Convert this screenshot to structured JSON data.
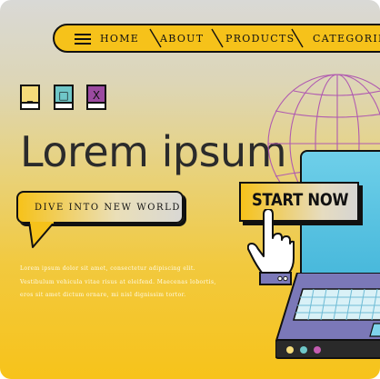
{
  "nav": {
    "items": [
      {
        "label": "HOME"
      },
      {
        "label": "ABOUT"
      },
      {
        "label": "PRODUCTS"
      },
      {
        "label": "CATEGORIES"
      }
    ]
  },
  "window_icons": [
    {
      "icon": "minimize-icon",
      "glyph": "_",
      "color": "#f6dc7a"
    },
    {
      "icon": "maximize-icon",
      "glyph": "□",
      "color": "#6fc7c8"
    },
    {
      "icon": "close-icon",
      "glyph": "X",
      "color": "#9b4aa0"
    }
  ],
  "hero": {
    "title": "Lorem ipsum",
    "bubble_label": "DIVE INTO NEW WORLD",
    "body_lines": [
      "Lorem ipsum dolor sit amet, consectetur adipiscing elit.",
      "Vestibulum vehicula vitae risus at eleifend. Maecenas lobortis,",
      "eros sit amet dictum ornare, mi nisl dignissim tortor."
    ]
  },
  "cta": {
    "label": "START NOW"
  },
  "colors": {
    "accent": "#f6c21a",
    "outline": "#111111",
    "screen": "#4fbfe0",
    "laptop": "#7b78b8",
    "globe_lines": "#b05ab0"
  }
}
